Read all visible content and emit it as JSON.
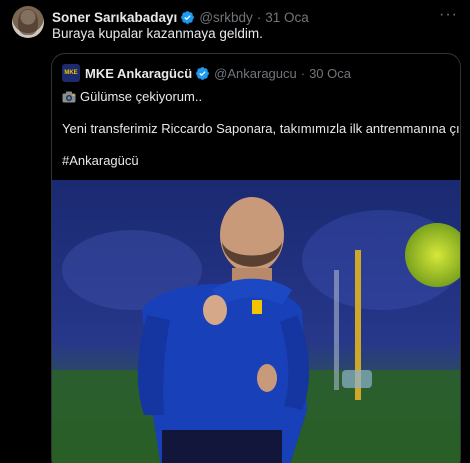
{
  "tweet": {
    "author_name": "Soner Sarıkabadayı",
    "author_handle": "@srkbdy",
    "separator": "·",
    "date": "31 Oca",
    "text": "Buraya kupalar kazanmaya geldim.",
    "more_icon": "more-icon"
  },
  "quote": {
    "logo_text": "MKE",
    "author_name": "MKE Ankaragücü",
    "author_handle": "@Ankaragucu",
    "separator": "·",
    "date": "30 Oca",
    "lines": [
      "Gülümse çekiyorum..",
      "Yeni transferimiz Riccardo Saponara, takımımızla ilk antrenmanına çıktı.",
      "#Ankaragücü"
    ]
  },
  "colors": {
    "background": "#000000",
    "text": "#e7e9ea",
    "muted": "#71767b",
    "verified": "#1d9bf0",
    "border": "#2f3336"
  }
}
